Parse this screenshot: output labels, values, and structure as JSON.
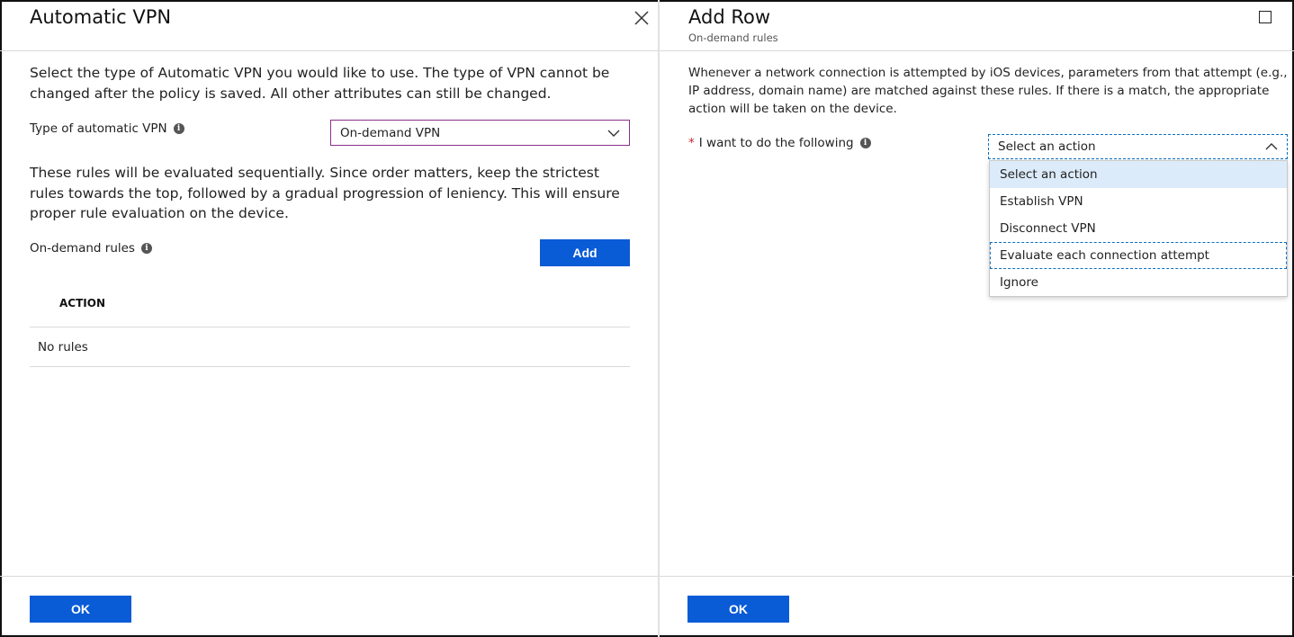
{
  "left_blade": {
    "title": "Automatic VPN",
    "intro": "Select the type of Automatic VPN you would like to use. The type of VPN cannot be changed after the policy is saved. All other attributes can still be changed.",
    "type_label": "Type of automatic VPN",
    "type_value": "On-demand VPN",
    "rules_description": "These rules will be evaluated sequentially. Since order matters, keep the strictest rules towards the top, followed by a gradual progression of leniency. This will ensure proper rule evaluation on the device.",
    "on_demand_label": "On-demand rules",
    "add_button": "Add",
    "table": {
      "column_action": "ACTION",
      "empty_text": "No rules"
    },
    "ok_button": "OK"
  },
  "right_blade": {
    "title": "Add Row",
    "subtitle": "On-demand rules",
    "description": "Whenever a network connection is attempted by iOS devices, parameters from that attempt (e.g., IP address, domain name) are matched against these rules. If there is a match, the appropriate action will be taken on the device.",
    "required_mark": "*",
    "action_label": "I want to do the following",
    "action_value": "Select an action",
    "options": [
      "Select an action",
      "Establish VPN",
      "Disconnect VPN",
      "Evaluate each connection attempt",
      "Ignore"
    ],
    "ok_button": "OK"
  },
  "icons": {
    "info": "info-icon",
    "close": "close-icon",
    "maximize": "maximize-icon",
    "chevron_down": "chevron-down-icon",
    "chevron_up": "chevron-up-icon"
  },
  "colors": {
    "primary_button": "#0a5bd6",
    "select_border": "#8a2f8a",
    "focus_dashed": "#0a6fc2",
    "selected_option": "#dcebfa",
    "required": "#c4262e"
  }
}
